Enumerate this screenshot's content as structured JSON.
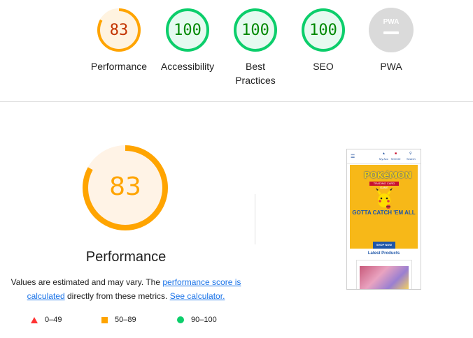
{
  "categories": [
    {
      "id": "performance",
      "score": "83",
      "label": "Performance",
      "color": "#ffa400",
      "fraction": 0.83
    },
    {
      "id": "accessibility",
      "score": "100",
      "label": "Accessibility",
      "color": "#0cce6b",
      "fraction": 1.0
    },
    {
      "id": "best-practices",
      "score": "100",
      "label": "Best Practices",
      "color": "#0cce6b",
      "fraction": 1.0
    },
    {
      "id": "seo",
      "score": "100",
      "label": "SEO",
      "color": "#0cce6b",
      "fraction": 1.0
    },
    {
      "id": "pwa",
      "score": "",
      "label": "PWA",
      "badge": "PWA",
      "color": "#bdbdbd",
      "fraction": 0
    }
  ],
  "main": {
    "score": "83",
    "fraction": 0.83,
    "title": "Performance",
    "desc_before": "Values are estimated and may vary. The ",
    "desc_link1": "performance score is calculated",
    "desc_middle": " directly from these metrics. ",
    "desc_link2": "See calculator.",
    "color": "#ffa400"
  },
  "legend": [
    {
      "shape": "triangle",
      "range": "0–49",
      "color": "#ff3333"
    },
    {
      "shape": "square",
      "range": "50–89",
      "color": "#ffa400"
    },
    {
      "shape": "circle",
      "range": "90–100",
      "color": "#0cce6b"
    }
  ],
  "screenshot": {
    "nav_items": [
      "My Acc",
      "$ 00.00",
      "Search"
    ],
    "brand": "POKéMON",
    "subbrand": "TRADING CARD GAME",
    "headline": "GOTTA CATCH 'EM ALL",
    "cta": "SHOP NOW",
    "latest": "Latest Products"
  }
}
